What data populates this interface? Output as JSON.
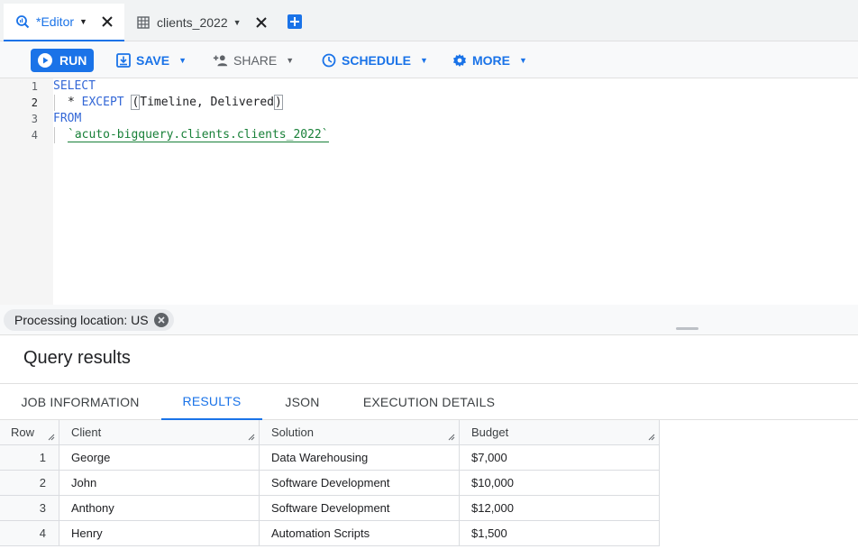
{
  "tabs": [
    {
      "label": "*Editor",
      "icon": "query-icon",
      "active": true
    },
    {
      "label": "clients_2022",
      "icon": "table-icon",
      "active": false
    }
  ],
  "toolbar": {
    "run": "RUN",
    "save": "SAVE",
    "share": "SHARE",
    "schedule": "SCHEDULE",
    "more": "MORE"
  },
  "editor": {
    "line_numbers": [
      "1",
      "2",
      "3",
      "4"
    ],
    "line1": "SELECT",
    "line2_star": "*",
    "line2_kw": "EXCEPT",
    "line2_open": "(",
    "line2_cols": "Timeline, Delivered",
    "line2_close": ")",
    "line3": "FROM",
    "line4": "`acuto-bigquery.clients.clients_2022`"
  },
  "location": {
    "label": "Processing location: US"
  },
  "results": {
    "title": "Query results",
    "tabs": [
      "JOB INFORMATION",
      "RESULTS",
      "JSON",
      "EXECUTION DETAILS"
    ],
    "active_tab": "RESULTS",
    "columns": [
      "Row",
      "Client",
      "Solution",
      "Budget"
    ],
    "rows": [
      [
        "1",
        "George",
        "Data Warehousing",
        "$7,000"
      ],
      [
        "2",
        "John",
        "Software Development",
        "$10,000"
      ],
      [
        "3",
        "Anthony",
        "Software Development",
        "$12,000"
      ],
      [
        "4",
        "Henry",
        "Automation Scripts",
        "$1,500"
      ]
    ]
  },
  "colors": {
    "accent": "#1a73e8",
    "keyword": "#3367d6",
    "string": "#188038"
  }
}
